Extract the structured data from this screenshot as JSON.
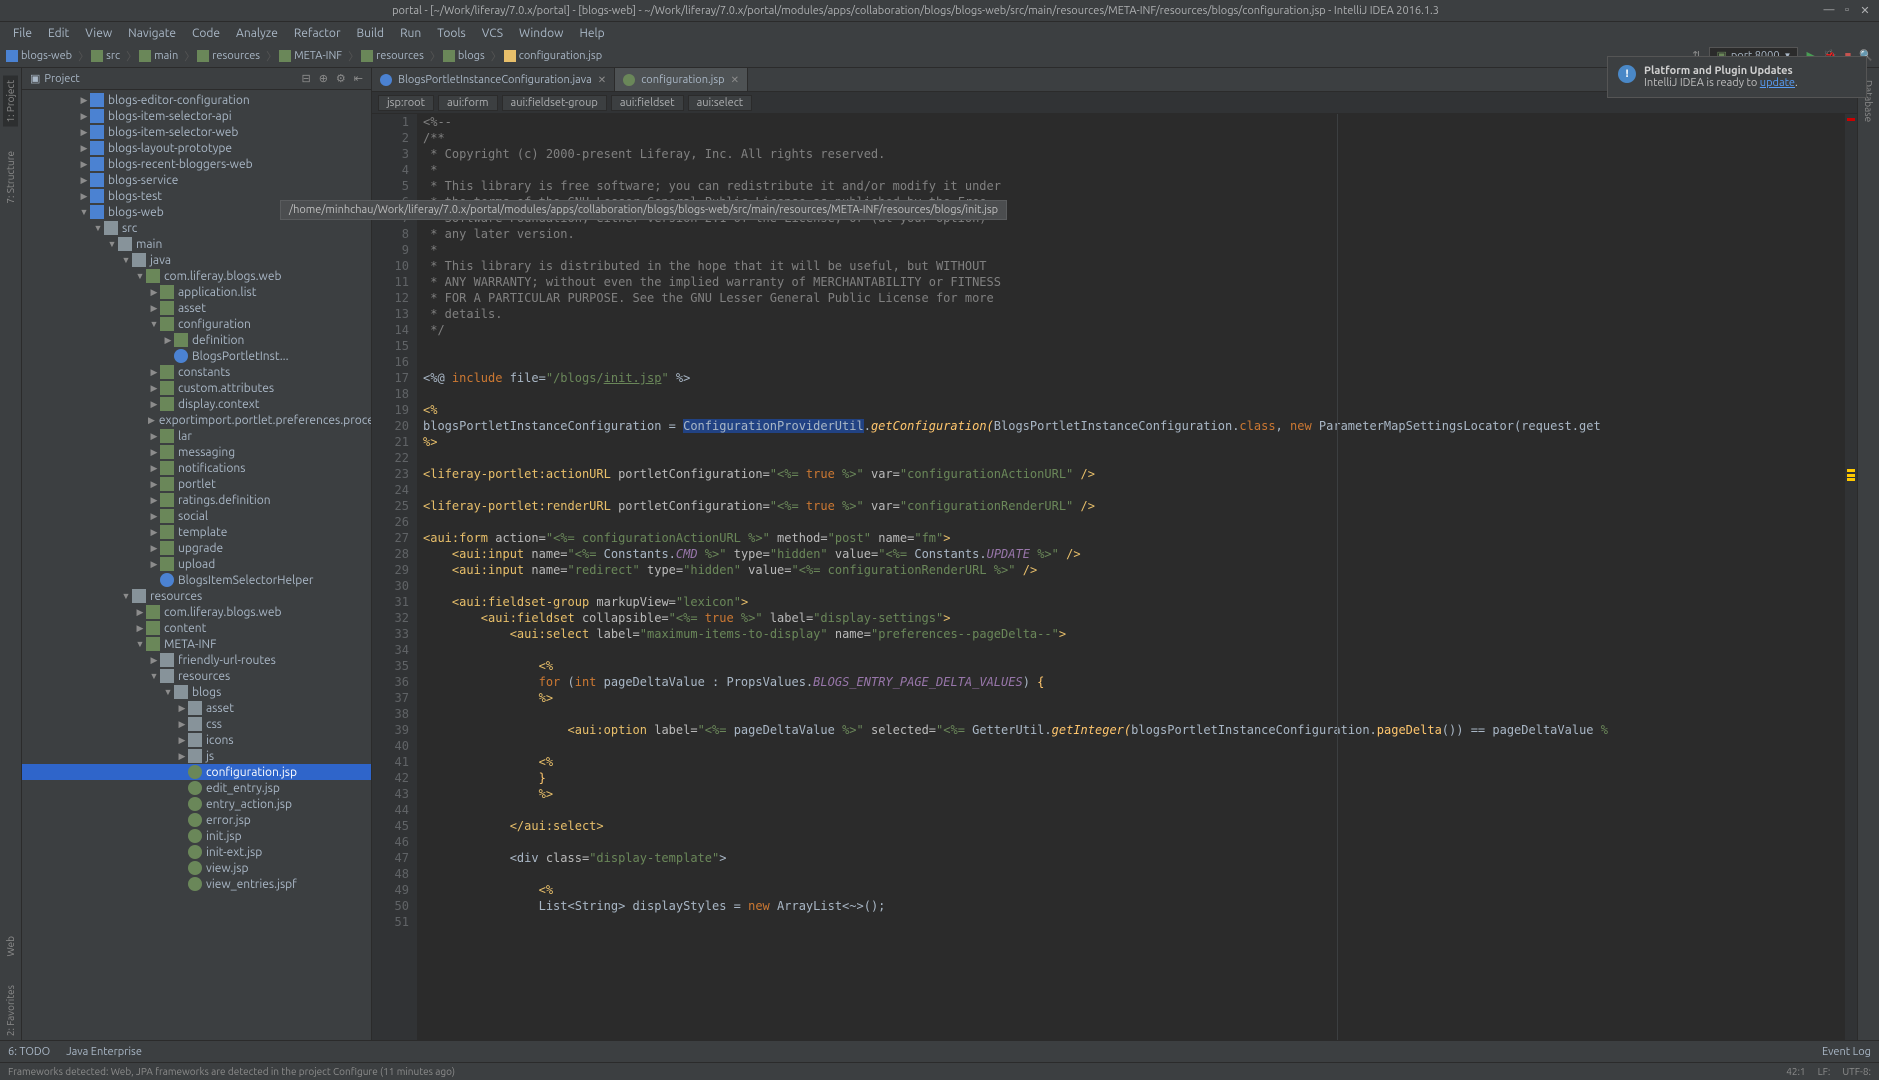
{
  "title": "portal - [~/Work/liferay/7.0.x/portal] - [blogs-web] - ~/Work/liferay/7.0.x/portal/modules/apps/collaboration/blogs/blogs-web/src/main/resources/META-INF/resources/blogs/configuration.jsp - IntelliJ IDEA 2016.1.3",
  "menu": [
    "File",
    "Edit",
    "View",
    "Navigate",
    "Code",
    "Analyze",
    "Refactor",
    "Build",
    "Run",
    "Tools",
    "VCS",
    "Window",
    "Help"
  ],
  "nav": {
    "crumbs": [
      "blogs-web",
      "src",
      "main",
      "resources",
      "META-INF",
      "resources",
      "blogs",
      "configuration.jsp"
    ],
    "runconf": "port 8000"
  },
  "balloon": {
    "title": "Platform and Plugin Updates",
    "text_pre": "IntelliJ IDEA is ready to ",
    "link": "update",
    "text_post": "."
  },
  "tooltip": "/home/minhchau/Work/liferay/7.0.x/portal/modules/apps/collaboration/blogs/blogs-web/src/main/resources/META-INF/resources/blogs/init.jsp",
  "left_tabs": [
    "1: Project",
    "7: Structure"
  ],
  "left_tabs2": [
    "Web",
    "2: Favorites"
  ],
  "right_tabs": [
    "Database"
  ],
  "project_header": "Project",
  "tree": [
    {
      "d": 4,
      "a": "▶",
      "i": "mod",
      "t": "blogs-editor-configuration"
    },
    {
      "d": 4,
      "a": "▶",
      "i": "mod",
      "t": "blogs-item-selector-api"
    },
    {
      "d": 4,
      "a": "▶",
      "i": "mod",
      "t": "blogs-item-selector-web"
    },
    {
      "d": 4,
      "a": "▶",
      "i": "mod",
      "t": "blogs-layout-prototype"
    },
    {
      "d": 4,
      "a": "▶",
      "i": "mod",
      "t": "blogs-recent-bloggers-web"
    },
    {
      "d": 4,
      "a": "▶",
      "i": "mod",
      "t": "blogs-service"
    },
    {
      "d": 4,
      "a": "▶",
      "i": "mod",
      "t": "blogs-test"
    },
    {
      "d": 4,
      "a": "▼",
      "i": "mod",
      "t": "blogs-web"
    },
    {
      "d": 5,
      "a": "▼",
      "i": "folder",
      "t": "src"
    },
    {
      "d": 6,
      "a": "▼",
      "i": "folder",
      "t": "main"
    },
    {
      "d": 7,
      "a": "▼",
      "i": "folder",
      "t": "java"
    },
    {
      "d": 8,
      "a": "▼",
      "i": "pkg",
      "t": "com.liferay.blogs.web"
    },
    {
      "d": 9,
      "a": "▶",
      "i": "pkg",
      "t": "application.list"
    },
    {
      "d": 9,
      "a": "▶",
      "i": "pkg",
      "t": "asset"
    },
    {
      "d": 9,
      "a": "▼",
      "i": "pkg",
      "t": "configuration"
    },
    {
      "d": 10,
      "a": "▶",
      "i": "pkg",
      "t": "definition"
    },
    {
      "d": 10,
      "a": "",
      "i": "java",
      "t": "BlogsPortletInst..."
    },
    {
      "d": 9,
      "a": "▶",
      "i": "pkg",
      "t": "constants"
    },
    {
      "d": 9,
      "a": "▶",
      "i": "pkg",
      "t": "custom.attributes"
    },
    {
      "d": 9,
      "a": "▶",
      "i": "pkg",
      "t": "display.context"
    },
    {
      "d": 9,
      "a": "▶",
      "i": "pkg",
      "t": "exportimport.portlet.preferences.process"
    },
    {
      "d": 9,
      "a": "▶",
      "i": "pkg",
      "t": "lar"
    },
    {
      "d": 9,
      "a": "▶",
      "i": "pkg",
      "t": "messaging"
    },
    {
      "d": 9,
      "a": "▶",
      "i": "pkg",
      "t": "notifications"
    },
    {
      "d": 9,
      "a": "▶",
      "i": "pkg",
      "t": "portlet"
    },
    {
      "d": 9,
      "a": "▶",
      "i": "pkg",
      "t": "ratings.definition"
    },
    {
      "d": 9,
      "a": "▶",
      "i": "pkg",
      "t": "social"
    },
    {
      "d": 9,
      "a": "▶",
      "i": "pkg",
      "t": "template"
    },
    {
      "d": 9,
      "a": "▶",
      "i": "pkg",
      "t": "upgrade"
    },
    {
      "d": 9,
      "a": "▶",
      "i": "pkg",
      "t": "upload"
    },
    {
      "d": 9,
      "a": "",
      "i": "java",
      "t": "BlogsItemSelectorHelper"
    },
    {
      "d": 7,
      "a": "▼",
      "i": "folder",
      "t": "resources"
    },
    {
      "d": 8,
      "a": "▶",
      "i": "pkg",
      "t": "com.liferay.blogs.web"
    },
    {
      "d": 8,
      "a": "▶",
      "i": "pkg",
      "t": "content"
    },
    {
      "d": 8,
      "a": "▼",
      "i": "pkg",
      "t": "META-INF"
    },
    {
      "d": 9,
      "a": "▶",
      "i": "folder",
      "t": "friendly-url-routes"
    },
    {
      "d": 9,
      "a": "▼",
      "i": "folder",
      "t": "resources"
    },
    {
      "d": 10,
      "a": "▼",
      "i": "folder",
      "t": "blogs"
    },
    {
      "d": 11,
      "a": "▶",
      "i": "folder",
      "t": "asset"
    },
    {
      "d": 11,
      "a": "▶",
      "i": "folder",
      "t": "css"
    },
    {
      "d": 11,
      "a": "▶",
      "i": "folder",
      "t": "icons"
    },
    {
      "d": 11,
      "a": "▶",
      "i": "folder",
      "t": "js"
    },
    {
      "d": 11,
      "a": "",
      "i": "web",
      "t": "configuration.jsp",
      "sel": true
    },
    {
      "d": 11,
      "a": "",
      "i": "web",
      "t": "edit_entry.jsp"
    },
    {
      "d": 11,
      "a": "",
      "i": "web",
      "t": "entry_action.jsp"
    },
    {
      "d": 11,
      "a": "",
      "i": "web",
      "t": "error.jsp"
    },
    {
      "d": 11,
      "a": "",
      "i": "web",
      "t": "init.jsp"
    },
    {
      "d": 11,
      "a": "",
      "i": "web",
      "t": "init-ext.jsp"
    },
    {
      "d": 11,
      "a": "",
      "i": "web",
      "t": "view.jsp"
    },
    {
      "d": 11,
      "a": "",
      "i": "web",
      "t": "view_entries.jspf"
    }
  ],
  "tabs": [
    {
      "icon": "java",
      "label": "BlogsPortletInstanceConfiguration.java",
      "active": false
    },
    {
      "icon": "web",
      "label": "configuration.jsp",
      "active": true
    }
  ],
  "breadcrumb": [
    "jsp:root",
    "aui:form",
    "aui:fieldset-group",
    "aui:fieldset",
    "aui:select"
  ],
  "bottom": {
    "l1": "6: TODO",
    "l2": "Java Enterprise",
    "r1": "Event Log"
  },
  "status": {
    "msg": "Frameworks detected: Web, JPA frameworks are detected in the project Configure (11 minutes ago)",
    "pos": "42:1",
    "le": "LF:",
    "enc": "UTF-8:"
  }
}
